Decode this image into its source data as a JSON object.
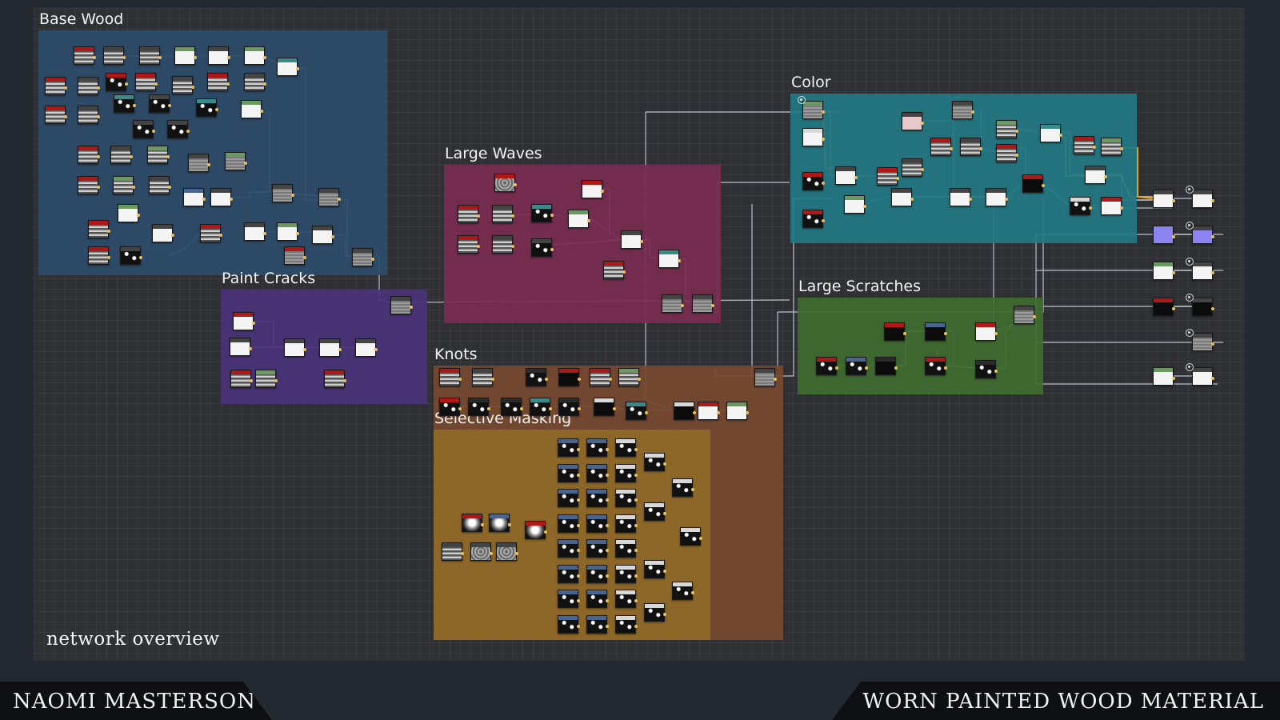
{
  "canvas_label": "network overview",
  "footer": {
    "author": "NAOMI  MASTERSON",
    "title": "WORN  PAINTED  WOOD  MATERIAL"
  },
  "colors": {
    "base_wood": "#2d4c6a",
    "paint_cracks": "#4a347a",
    "large_waves": "#7a2c50",
    "knots": "#774a30",
    "selective_masking": "#8e6a28",
    "color": "#237a84",
    "large_scratches": "#3f6d2f"
  },
  "frames": [
    {
      "id": "base_wood",
      "title": "Base Wood"
    },
    {
      "id": "paint_cracks",
      "title": "Paint Cracks"
    },
    {
      "id": "large_waves",
      "title": "Large Waves"
    },
    {
      "id": "knots",
      "title": "Knots"
    },
    {
      "id": "selective_masking",
      "title": "Selective Masking"
    },
    {
      "id": "color",
      "title": "Color"
    },
    {
      "id": "large_scratches",
      "title": "Large Scratches"
    }
  ],
  "output_nodes": [
    {
      "name": "basecolor-output",
      "icon": "output-icon"
    },
    {
      "name": "normal-output",
      "icon": "output-icon"
    },
    {
      "name": "roughness-output",
      "icon": "output-icon"
    },
    {
      "name": "metallic-output",
      "icon": "output-icon"
    },
    {
      "name": "height-output",
      "icon": "output-icon"
    },
    {
      "name": "ambient-occlusion-output",
      "icon": "output-icon"
    }
  ]
}
